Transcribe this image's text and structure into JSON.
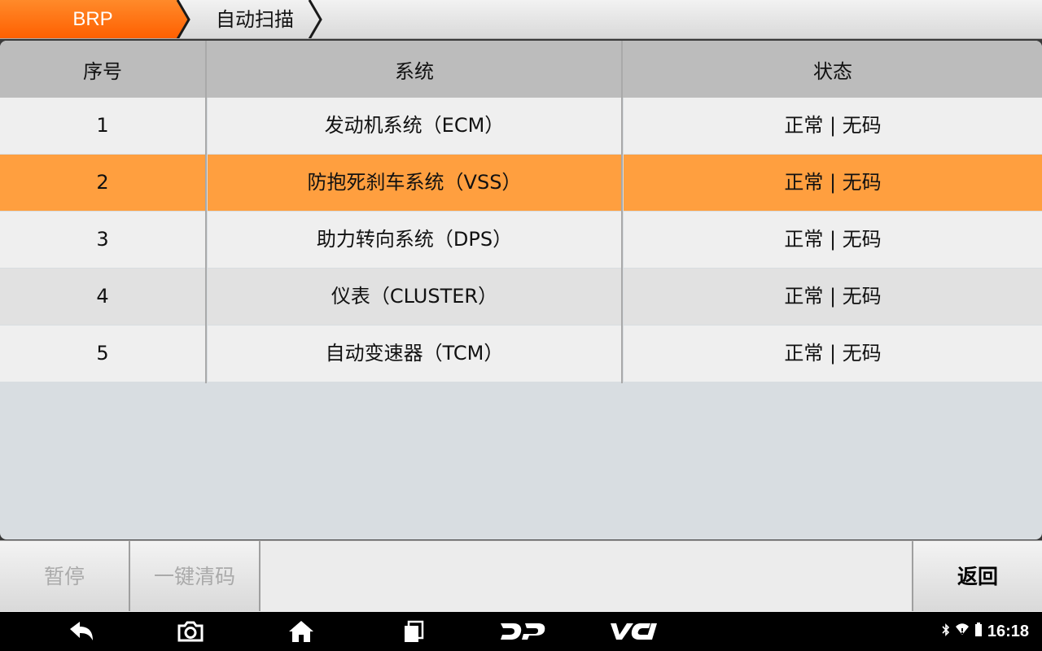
{
  "breadcrumb": {
    "root": "BRP",
    "current": "自动扫描"
  },
  "colors": {
    "accent": "#ff6a00",
    "selected_row": "#ff9f3f"
  },
  "table": {
    "headers": [
      "序号",
      "系统",
      "状态"
    ],
    "selected_index": 1,
    "rows": [
      {
        "no": "1",
        "system": "发动机系统（ECM）",
        "status": "正常 | 无码"
      },
      {
        "no": "2",
        "system": "防抱死刹车系统（VSS）",
        "status": "正常 | 无码"
      },
      {
        "no": "3",
        "system": "助力转向系统（DPS）",
        "status": "正常 | 无码"
      },
      {
        "no": "4",
        "system": "仪表（CLUSTER）",
        "status": "正常 | 无码"
      },
      {
        "no": "5",
        "system": "自动变速器（TCM）",
        "status": "正常 | 无码"
      }
    ]
  },
  "buttons": {
    "pause": "暂停",
    "clear_codes": "一键清码",
    "back": "返回"
  },
  "navbar": {
    "icons": [
      "back-arrow-icon",
      "camera-icon",
      "home-icon",
      "recent-apps-icon",
      "dp-logo-icon",
      "vci-logo-icon"
    ],
    "status_icons": [
      "bluetooth-icon",
      "wifi-icon",
      "battery-icon"
    ],
    "clock": "16:18"
  }
}
